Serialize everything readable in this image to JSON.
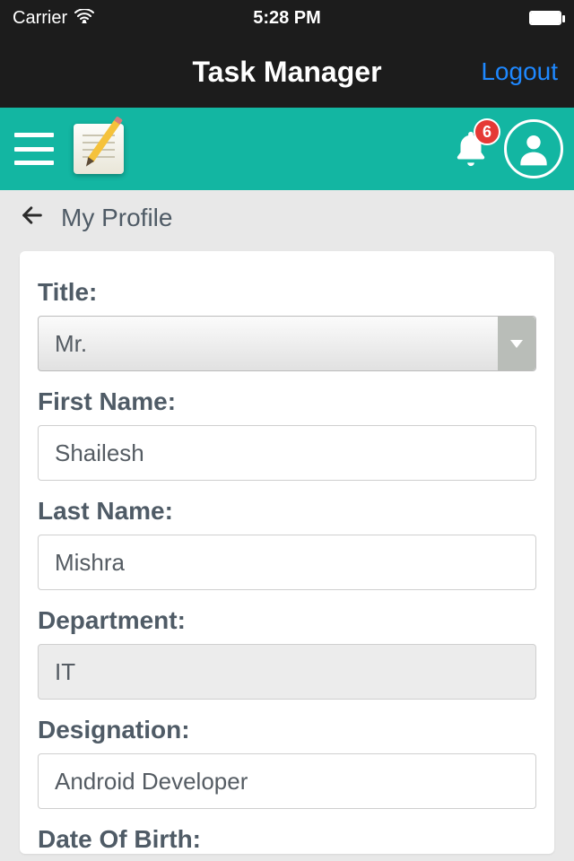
{
  "statusbar": {
    "carrier": "Carrier",
    "time": "5:28 PM"
  },
  "navbar": {
    "title": "Task Manager",
    "logout": "Logout"
  },
  "toolbar": {
    "notification_count": "6"
  },
  "breadcrumb": {
    "pageTitle": "My Profile"
  },
  "form": {
    "titleLabel": "Title:",
    "titleValue": "Mr.",
    "firstNameLabel": "First Name:",
    "firstNameValue": "Shailesh",
    "lastNameLabel": "Last Name:",
    "lastNameValue": "Mishra",
    "departmentLabel": "Department:",
    "departmentValue": "IT",
    "designationLabel": "Designation:",
    "designationValue": "Android Developer",
    "dobLabel": "Date Of Birth:"
  }
}
